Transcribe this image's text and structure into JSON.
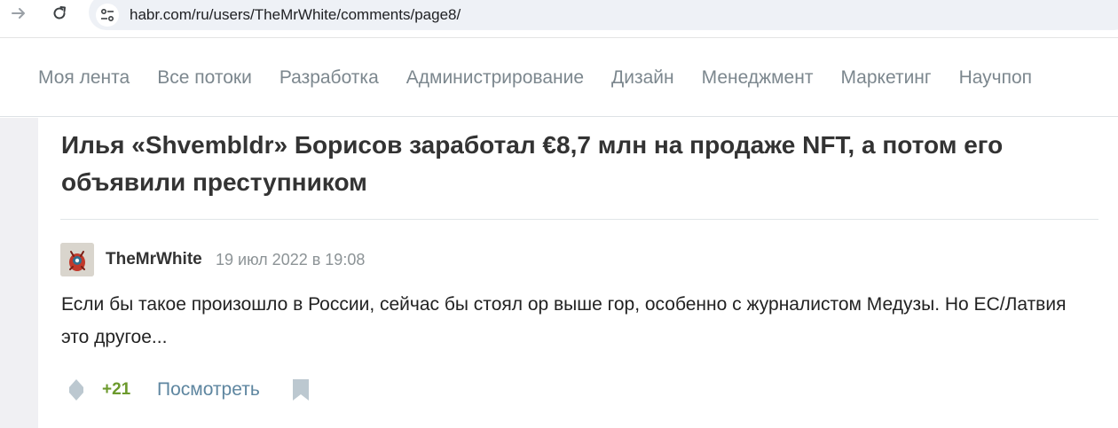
{
  "browser": {
    "url": "habr.com/ru/users/TheMrWhite/comments/page8/",
    "icons": {
      "forward": "arrow-right-icon",
      "reload": "reload-icon",
      "site_info": "tune-icon"
    }
  },
  "site_nav": {
    "items": [
      {
        "label": "Моя лента"
      },
      {
        "label": "Все потоки"
      },
      {
        "label": "Разработка"
      },
      {
        "label": "Администрирование"
      },
      {
        "label": "Дизайн"
      },
      {
        "label": "Менеджмент"
      },
      {
        "label": "Маркетинг"
      },
      {
        "label": "Научпоп"
      }
    ]
  },
  "post": {
    "title": "Илья «Shvembldr» Борисов заработал €8,7 млн на продаже NFT, а потом его объявили преступником"
  },
  "comment": {
    "author": "TheMrWhite",
    "timestamp": "19 июл 2022 в 19:08",
    "text": "Если бы такое произошло в России, сейчас бы стоял ор выше гор, особенно с журналистом Медузы. Но ЕС/Латвия это другое...",
    "score": "+21",
    "view_label": "Посмотреть"
  },
  "colors": {
    "score_positive": "#6c9a2d",
    "link": "#5e86a0",
    "icon_gray": "#bcc8d0"
  }
}
